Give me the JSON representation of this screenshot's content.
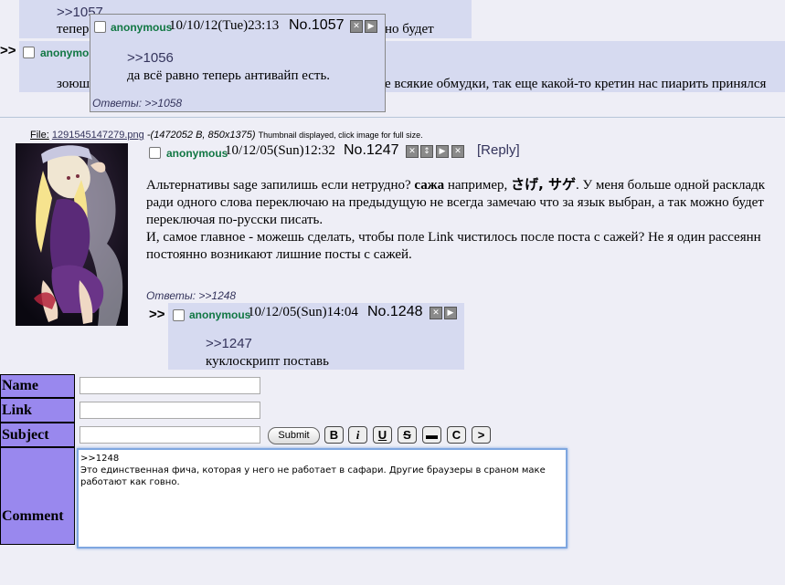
{
  "p1057_bg": {
    "quote": ">>1057",
    "text_left": "тепер",
    "text_right": "но будет"
  },
  "p_bg2": {
    "arrow": ">>",
    "name": "anonymous",
    "text_left": "зоюш",
    "text_right": "е всякие обмудки, так еще какой-то кретин нас пиарить принялся"
  },
  "popup": {
    "name": "anonymous",
    "date": "10/10/12(Tue)23:13",
    "number": "No.1057",
    "quote": ">>1056",
    "text": "да всё равно теперь антивайп есть.",
    "replies_label": "Ответы:",
    "replies_link": ">>1058"
  },
  "op": {
    "file_label": "File:",
    "file_name": "1291545147279.png",
    "file_info_prefix": " -(",
    "file_info": "1472052 B, 850x1375",
    "file_info_suffix": ")",
    "thumb_note": "Thumbnail displayed, click image for full size.",
    "name": "anonymous",
    "date": "10/12/05(Sun)12:32",
    "number": "No.1247",
    "reply_link": "[Reply]",
    "line1_a": "Альтернативы sage запилишь если нетрудно? ",
    "line1_bold": "сажа",
    "line1_b": " например, ",
    "line1_jp": "さげ, サゲ",
    "line1_c": ". У меня больше одной раскладк",
    "line2": "ради одного слова переключаю на предыдущую не всегда замечаю что за язык выбран, а так можно будет",
    "line3": "переключая по-русски писать.",
    "line4": "И, самое главное - можешь сделать, чтобы поле Link чистилось после поста с сажей? Не я один рассеянн",
    "line5": "постоянно возникают лишние посты с сажей.",
    "replies_label": "Ответы:",
    "replies_link": ">>1248"
  },
  "reply1248": {
    "arrow": ">>",
    "name": "anonymous",
    "date": "10/12/05(Sun)14:04",
    "number": "No.1248",
    "quote": ">>1247",
    "text": "куклоскрипт поставь"
  },
  "form": {
    "name_label": "Name",
    "link_label": "Link",
    "subject_label": "Subject",
    "comment_label": "Comment",
    "submit_label": "Submit",
    "tools": [
      "B",
      "i",
      "U",
      "S",
      "▬",
      "C",
      ">"
    ],
    "comment_line1": ">>1248",
    "comment_line2": "Это единственная фича, которая у него не работает в сафари. Другие браузеры в сраном маке",
    "comment_line3": "работают как говно."
  }
}
